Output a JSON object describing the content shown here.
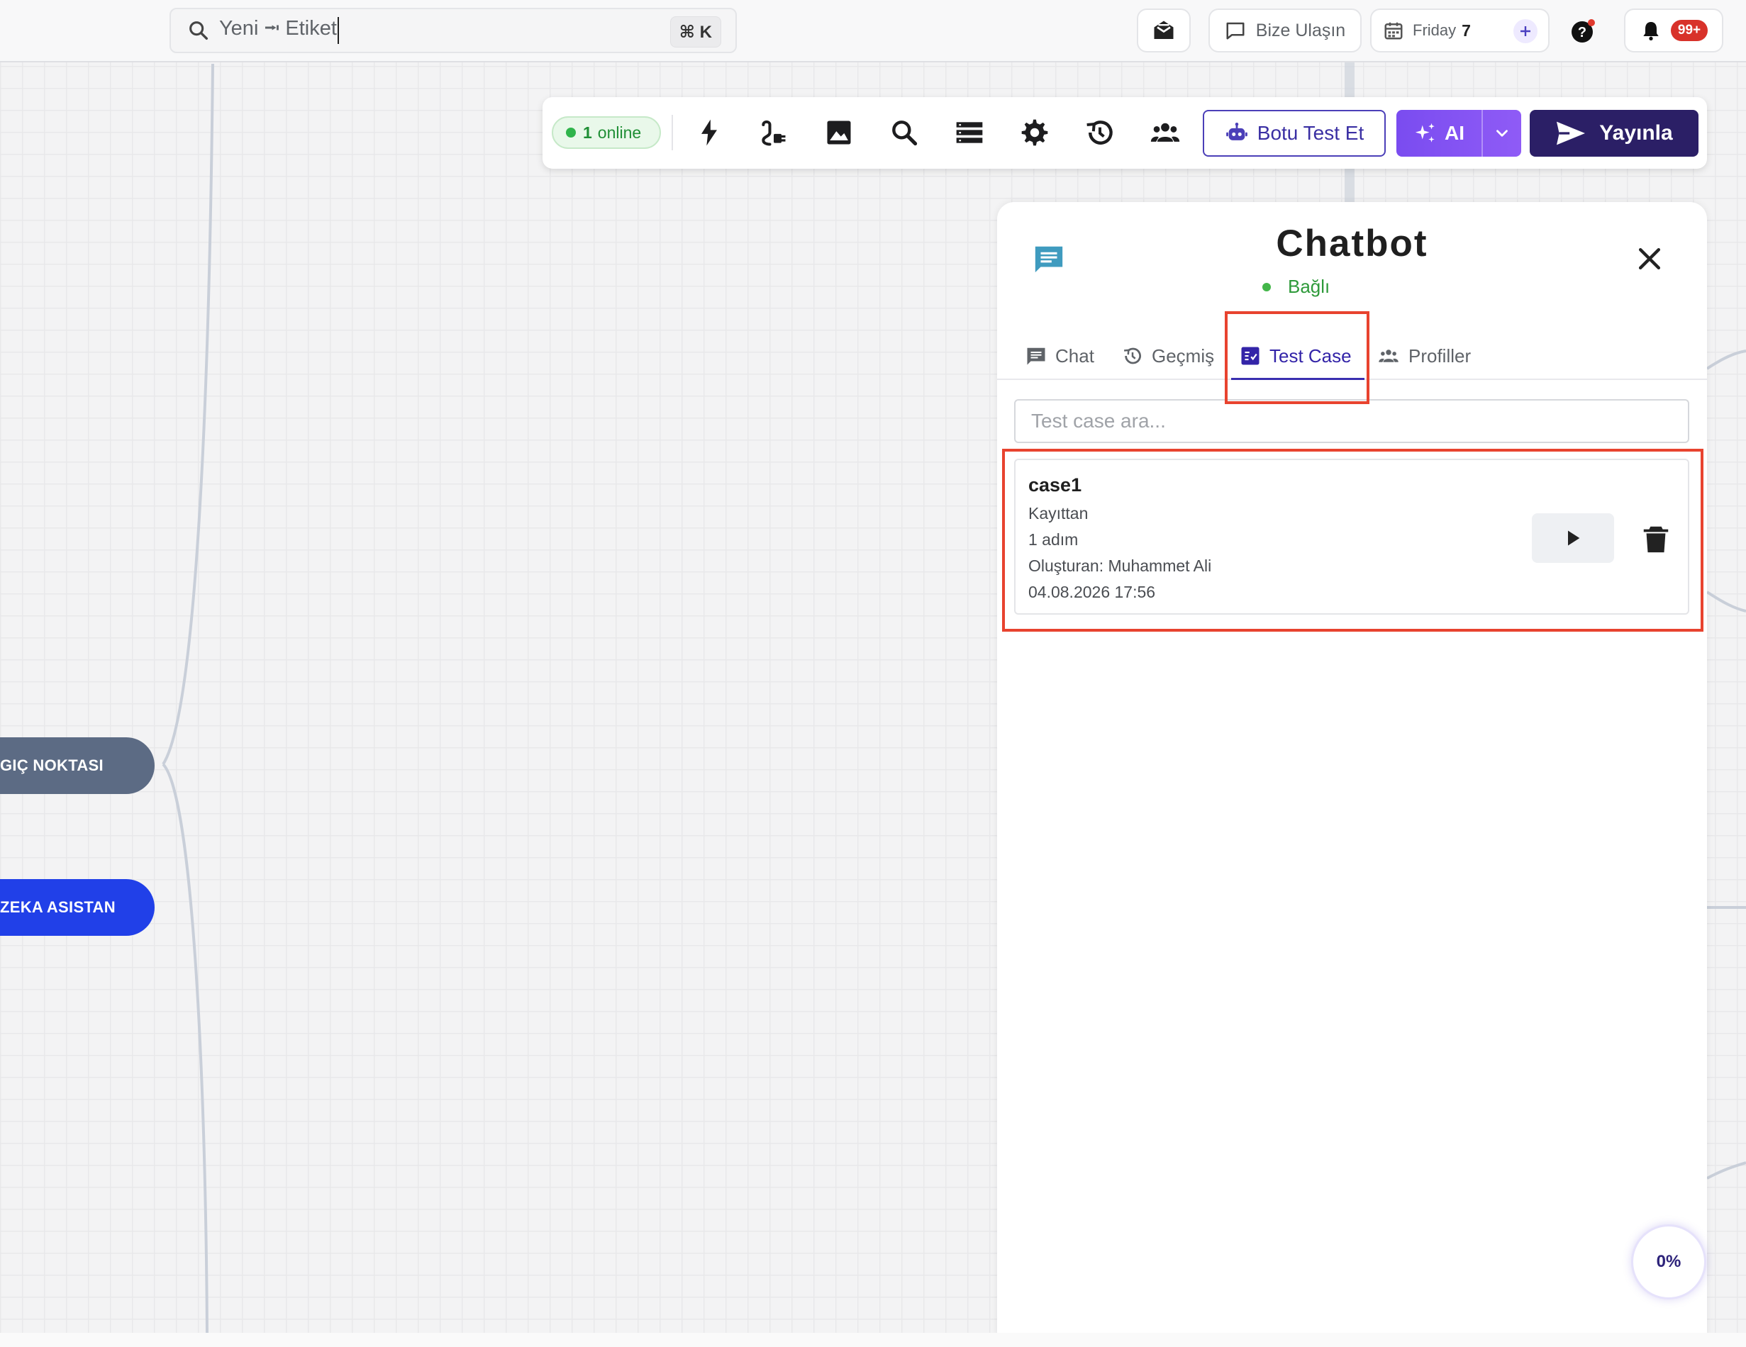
{
  "topbar": {
    "search_text": "Yeni ⭲ Etiket",
    "shortcut": "⌘ K",
    "contact_label": "Bize Ulaşın",
    "date_day": "Friday",
    "date_num": "7",
    "notif_badge": "99+",
    "icons": [
      "search-icon",
      "inbox-icon",
      "chat-bubble-icon",
      "calendar-icon",
      "plus-icon",
      "help-icon",
      "bell-icon"
    ]
  },
  "canvas": {
    "nodes": [
      {
        "label": "GIÇ NOKTASI",
        "color": "#5c6b84"
      },
      {
        "label": "ZEKA ASISTAN",
        "color": "#2140e8"
      }
    ]
  },
  "toolbar": {
    "online_count": "1",
    "online_label": "online",
    "test_label": "Botu Test Et",
    "ai_label": "AI",
    "publish_label": "Yayınla",
    "icons": [
      "bolt-icon",
      "plug-icon",
      "image-icon",
      "search-icon",
      "list-icon",
      "gear-icon",
      "history-icon",
      "users-icon"
    ]
  },
  "panel": {
    "title": "Chatbot",
    "status": "Bağlı",
    "tabs": [
      {
        "label": "Chat",
        "icon": "chat-icon"
      },
      {
        "label": "Geçmiş",
        "icon": "history-icon"
      },
      {
        "label": "Test Case",
        "icon": "checklist-icon"
      },
      {
        "label": "Profiller",
        "icon": "users-icon"
      }
    ],
    "active_tab": "Test Case",
    "search_placeholder": "Test case ara...",
    "cases": [
      {
        "name": "case1",
        "source": "Kayıttan",
        "steps": "1 adım",
        "creator": "Oluşturan: Muhammet Ali",
        "datetime": "04.08.2026 17:56"
      }
    ],
    "progress": "0%"
  },
  "colors": {
    "accent": "#3324a8",
    "publish": "#2b1f66",
    "ai": "#8052f3",
    "online": "#2fb44b",
    "highlight": "#e8432f"
  }
}
